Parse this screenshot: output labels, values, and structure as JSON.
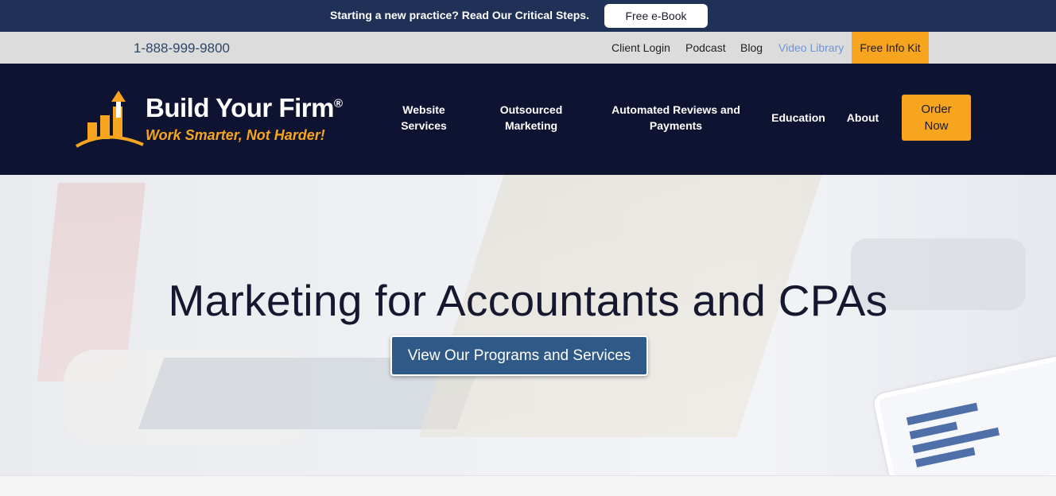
{
  "promo": {
    "text": "Starting a new practice? Read Our Critical Steps.",
    "button_label": "Free e-Book"
  },
  "utility": {
    "phone": "1-888-999-9800",
    "links": [
      "Client Login",
      "Podcast",
      "Blog",
      "Video Library"
    ],
    "info_kit_label": "Free Info Kit"
  },
  "brand": {
    "title": "Build Your Firm",
    "registered": "®",
    "tagline": "Work Smarter, Not Harder!",
    "colors": {
      "navy": "#0f1332",
      "gold": "#f7a51e",
      "promo": "#1f3157"
    }
  },
  "nav": {
    "items": [
      {
        "line1": "Website",
        "line2": "Services"
      },
      {
        "line1": "Outsourced",
        "line2": "Marketing"
      },
      {
        "line1": "Automated Reviews and",
        "line2": "Payments"
      },
      {
        "line1": "Education",
        "line2": ""
      },
      {
        "line1": "About",
        "line2": ""
      }
    ],
    "order_line1": "Order",
    "order_line2": "Now"
  },
  "hero": {
    "title": "Marketing for Accountants and CPAs",
    "button_label": "View Our Programs and Services"
  }
}
